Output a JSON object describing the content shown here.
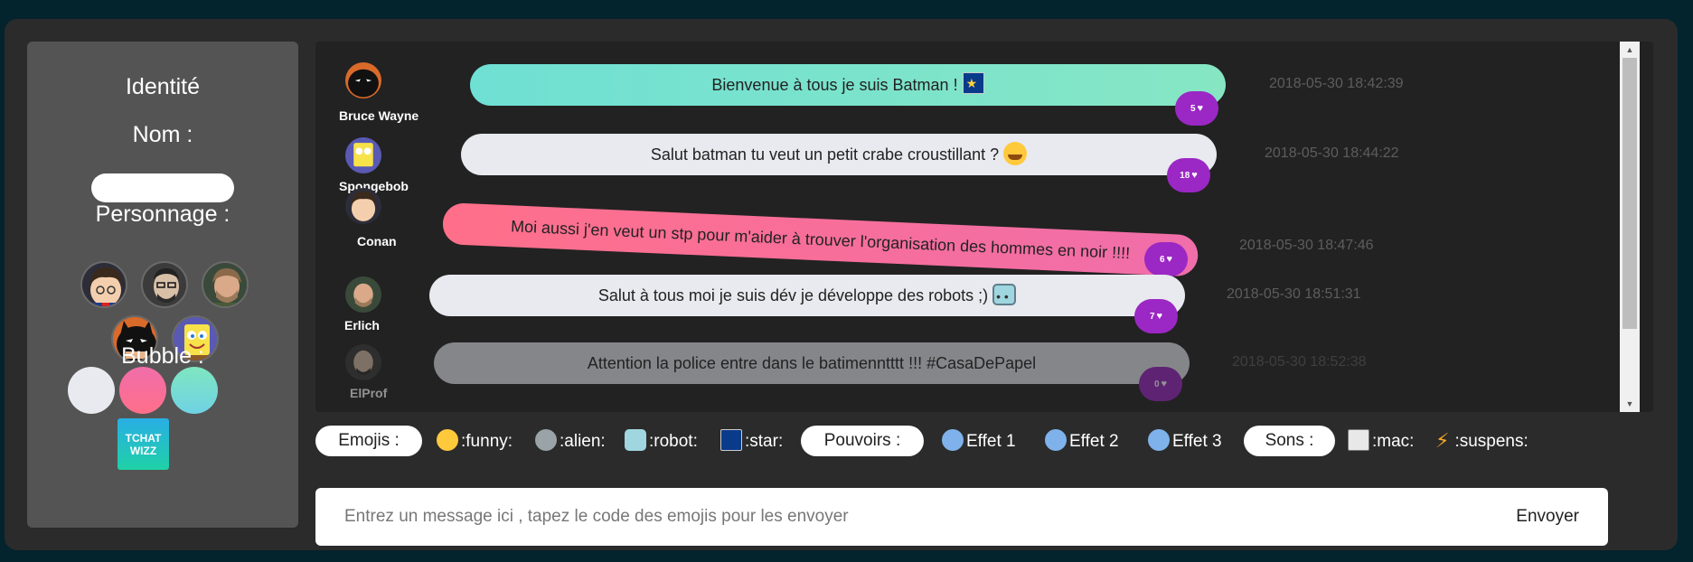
{
  "sidebar": {
    "identity_title": "Identité",
    "name_label": "Nom :",
    "name_value": "",
    "character_label": "Personnage :",
    "characters": [
      "Conan",
      "ElProf",
      "Erlich",
      "Bruce Wayne",
      "Spongebob"
    ],
    "bubble_label": "Bubble :",
    "bubble_colors": [
      "#e8eaef",
      "#ff6fa0",
      "#6fe0d4"
    ],
    "logo_line1": "TCHAT",
    "logo_line2": "WIZZ"
  },
  "messages": [
    {
      "author": "Bruce Wayne",
      "text": "Bienvenue à tous je suis Batman !",
      "emoji": "star",
      "likes": "5",
      "timestamp": "2018-05-30 18:42:39",
      "style": "gradient-teal"
    },
    {
      "author": "Spongebob",
      "text": "Salut batman tu veut un petit crabe croustillant ?",
      "emoji": "funny",
      "likes": "18",
      "timestamp": "2018-05-30 18:44:22",
      "style": "light"
    },
    {
      "author": "Conan",
      "text": "Moi aussi j'en veut un stp pour m'aider à trouver l'organisation des hommes en noir !!!!",
      "emoji": "",
      "likes": "6",
      "timestamp": "2018-05-30 18:47:46",
      "style": "gradient-pink"
    },
    {
      "author": "Erlich",
      "text": "Salut à tous moi je suis dév je développe des robots ;)",
      "emoji": "robot",
      "likes": "7",
      "timestamp": "2018-05-30 18:51:31",
      "style": "light"
    },
    {
      "author": "ElProf",
      "text": "Attention la police entre dans le batimenntttt !!! #CasaDePapel",
      "emoji": "",
      "likes": "0",
      "timestamp": "2018-05-30 18:52:38",
      "style": "faded"
    }
  ],
  "toolbar": {
    "emojis_label": "Emojis :",
    "emojis": [
      ":funny:",
      ":alien:",
      ":robot:",
      ":star:"
    ],
    "powers_label": "Pouvoirs :",
    "powers": [
      "Effet 1",
      "Effet 2",
      "Effet 3"
    ],
    "sounds_label": "Sons :",
    "sounds": [
      ":mac:",
      ":suspens:"
    ]
  },
  "composer": {
    "placeholder": "Entrez un message ici , tapez le code des emojis pour les envoyer",
    "send_label": "Envoyer"
  },
  "colors": {
    "like_badge": "#9b27c4",
    "bubble_light": "#e8eaef",
    "bubble_teal_from": "#6fe0d4",
    "bubble_teal_to": "#7fe6c0",
    "bubble_pink_from": "#ff6fa0",
    "bubble_pink_to": "#f06eaa"
  }
}
